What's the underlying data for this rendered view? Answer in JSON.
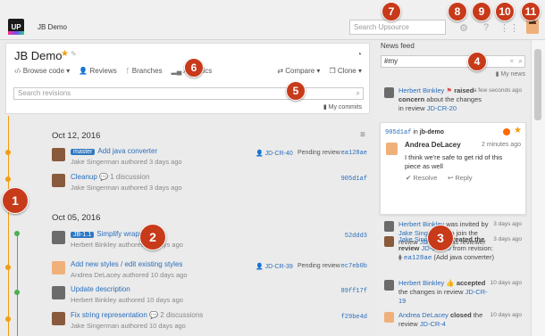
{
  "header": {
    "project": "JB Demo",
    "search_placeholder": "Search Upsource",
    "logo": "UP"
  },
  "project_card": {
    "title": "JB Demo",
    "nav": [
      "Browse code",
      "Reviews",
      "Branches",
      "Analytics"
    ],
    "actions": [
      "Compare",
      "Clone"
    ],
    "search_placeholder": "Search revisions",
    "my_commits": "My commits"
  },
  "dates": [
    "Oct 12, 2016",
    "Oct 05, 2016"
  ],
  "revisions": [
    {
      "tag": "master",
      "title": "Add java converter",
      "author": "Jake Singerman authored 3 days ago",
      "review": "JD-CR-40",
      "status": "Pending review",
      "hash": "ea128ae",
      "color": "#8a5a3c"
    },
    {
      "tag": "",
      "title": "Cleanup",
      "discussion": "1 discussion",
      "author": "Jake Singerman authored 3 days ago",
      "review": "",
      "status": "",
      "hash": "905d1af",
      "color": "#8a5a3c"
    },
    {
      "tag": "JB-1.1",
      "title": "Simplify wrapper",
      "author": "Herbert Binkley authored 10 days ago",
      "review": "",
      "status": "",
      "hash": "52ddd3",
      "color": "#6b6b6b"
    },
    {
      "tag": "",
      "title": "Add new styles / edit existing styles",
      "author": "Andrea DeLacey authored 10 days ago",
      "review": "JD-CR-39",
      "status": "Pending review",
      "hash": "ec7eb0b",
      "color": "#f0b07a"
    },
    {
      "tag": "",
      "title": "Update description",
      "author": "Herbert Binkley authored 10 days ago",
      "review": "",
      "status": "",
      "hash": "89ff17f",
      "color": "#6b6b6b"
    },
    {
      "tag": "",
      "title": "Fix string representation",
      "discussion": "2 discussions",
      "author": "Jake Singerman authored 10 days ago",
      "review": "",
      "status": "",
      "hash": "f29be4d",
      "color": "#8a5a3c"
    }
  ],
  "feed": {
    "title": "News feed",
    "query": "#my",
    "my_news": "My news",
    "card": {
      "hash": "905d1af",
      "in": "in",
      "project": "jb-demo",
      "author": "Andrea DeLacey",
      "time": "2 minutes ago",
      "text": "I think we're safe to get rid of this piece as well",
      "resolve": "Resolve",
      "reply": "Reply"
    },
    "items": [
      {
        "text_a": "Herbert Binkley",
        "text_b": "raised concern",
        "text_c": "about the changes in review",
        "link": "JD-CR-20",
        "time": "a few seconds ago"
      },
      {
        "text_a": "Herbert Binkley",
        "text_b": "was invited by",
        "text_c": "Jake Singerman",
        "text_d": "to join the review",
        "link": "JD-CR-40",
        "text_e": "as reviewer",
        "time": "3 days ago"
      },
      {
        "text_a": "Jake Singerman",
        "text_b": "created the review",
        "link": "JD-CR-40",
        "text_c": "from revision:",
        "hash": "ea128ae",
        "text_d": "(Add java converter)",
        "time": "3 days ago"
      },
      {
        "text_a": "Herbert Binkley",
        "text_b": "accepted",
        "text_c": "the changes in review",
        "link": "JD-CR-19",
        "time": "10 days ago"
      },
      {
        "text_a": "Andrea DeLacey",
        "text_b": "closed",
        "text_c": "the review",
        "link": "JD-CR-4",
        "time": "10 days ago"
      }
    ]
  },
  "markers": [
    "1",
    "2",
    "3",
    "4",
    "5",
    "6",
    "7",
    "8",
    "9",
    "10",
    "11"
  ],
  "colors": {
    "marker": "#c73a1a",
    "accent": "#2a6ebb",
    "timeline": "#f39c12",
    "timeline2": "#4caf50"
  }
}
